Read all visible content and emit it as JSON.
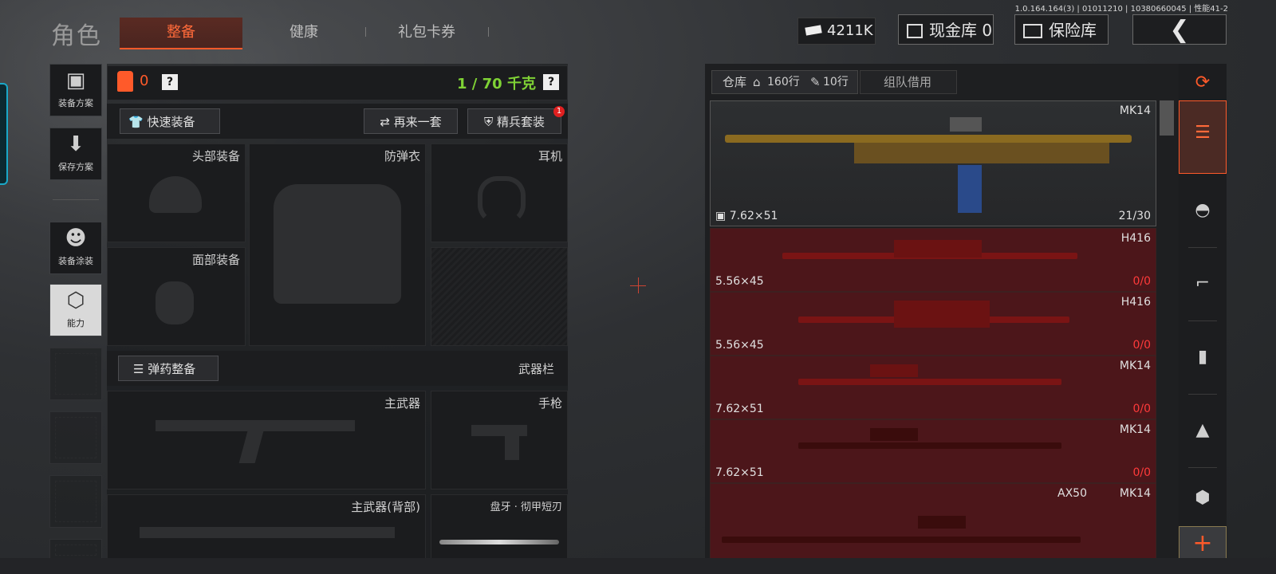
{
  "header": {
    "title": "角色",
    "tabs": [
      {
        "label": "整备",
        "active": true
      },
      {
        "label": "健康",
        "active": false
      },
      {
        "label": "礼包卡券",
        "active": false
      }
    ],
    "version": "1.0.164.164(3) | 01011210 | 10380660045 | 性能41-2",
    "money": "4211K",
    "cash_vault": "现金库 0",
    "insurance": "保险库",
    "back_icon": "chevron-left-icon"
  },
  "left_nav": [
    {
      "label": "装备方案",
      "icon": "vest-icon"
    },
    {
      "label": "保存方案",
      "icon": "download-icon"
    },
    {
      "label": "装备涂装",
      "icon": "helmet-paint-icon"
    },
    {
      "label": "能力",
      "icon": "ability-bolt-icon"
    }
  ],
  "equipment": {
    "vest_count": "0",
    "help": "?",
    "weight": "1 / 70 千克",
    "quick_equip": "快速装备",
    "again_set": "再来一套",
    "elite_set": "精兵套装",
    "elite_badge": "1",
    "slots": {
      "head": "头部装备",
      "armor": "防弹衣",
      "ear": "耳机",
      "face": "面部装备"
    },
    "ammo_equip": "弹药整备",
    "weapon_bar": "武器栏",
    "weapons": {
      "primary": "主武器",
      "pistol": "手枪",
      "primary_back": "主武器(背部)",
      "melee": "盘牙 · 彻甲短刃"
    }
  },
  "warehouse": {
    "tab_label": "仓库",
    "rows_home": "160行",
    "rows_ticket": "10行",
    "team_borrow": "组队借用",
    "items": [
      {
        "name": "MK14",
        "caliber": "7.62×51",
        "count": "21/30",
        "style": "gold"
      },
      {
        "name": "H416",
        "caliber": "5.56×45",
        "count_a": "0",
        "count_b": "/0",
        "style": "red"
      },
      {
        "name": "H416",
        "caliber": "5.56×45",
        "count_a": "0",
        "count_b": "/0",
        "style": "red"
      },
      {
        "name": "MK14",
        "caliber": "7.62×51",
        "count_a": "0",
        "count_b": "/0",
        "style": "red"
      },
      {
        "name": "MK14",
        "caliber": "7.62×51",
        "count_a": "0",
        "count_b": "/0",
        "style": "red"
      },
      {
        "name": "MK14",
        "extra": "AX50",
        "style": "red"
      }
    ]
  },
  "right_rail": [
    "stack-refresh-icon",
    "stack-icon",
    "helmet-icon",
    "rifle-icon",
    "magazine-icon",
    "bullet-icon",
    "armor-icon",
    "add-icon"
  ],
  "colors": {
    "accent": "#ff5a2a",
    "weight_green": "#7fd235",
    "item_red": "#4c161a"
  }
}
